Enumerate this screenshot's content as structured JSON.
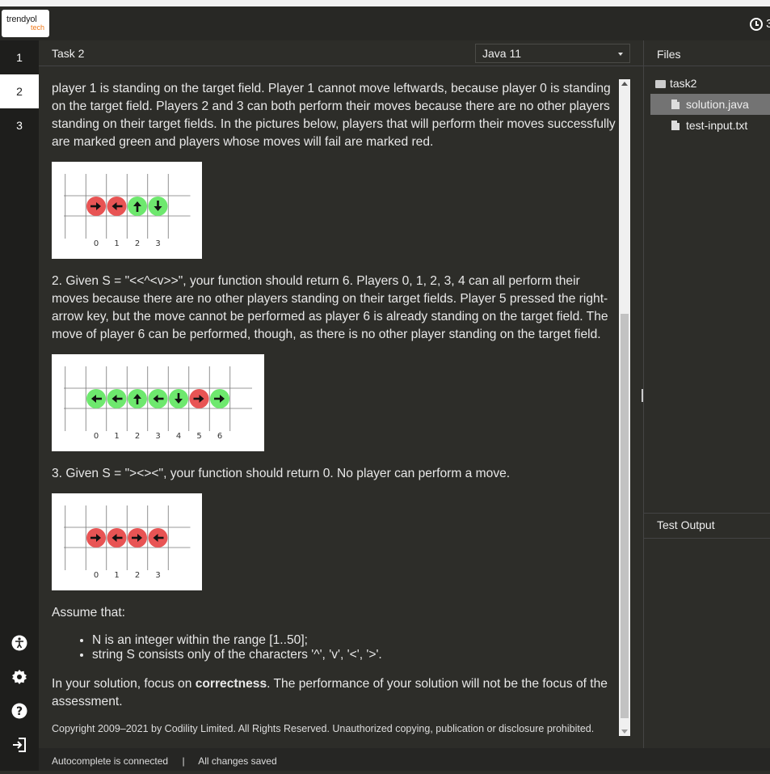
{
  "brand": {
    "line1": "trendyol",
    "line2": "tech"
  },
  "timer": {
    "text": "3"
  },
  "nav": {
    "tasks": [
      "1",
      "2",
      "3"
    ],
    "active": "2"
  },
  "nav_icons": [
    "accessibility-icon",
    "gear-icon",
    "help-icon",
    "logout-icon"
  ],
  "task": {
    "title": "Task 2",
    "language": "Java 11"
  },
  "content": {
    "para1": "player 1 is standing on the target field. Player 1 cannot move leftwards, because player 0 is standing on the target field. Players 2 and 3 can both perform their moves because there are no other players standing on their target fields. In the pictures below, players that will perform their moves successfully are marked green and players whose moves will fail are marked red.",
    "para2": "2. Given S = \"<<^<v>>\", your function should return 6. Players 0, 1, 2, 3, 4 can all perform their moves because there are no other players standing on their target fields. Player 5 pressed the right-arrow key, but the move cannot be performed as player 6 is already standing on the target field. The move of player 6 can be performed, though, as there is no other player standing on the target field.",
    "para3": "3. Given S = \"><><\", your function should return 0. No player can perform a move.",
    "assume": "Assume that:",
    "bullets": [
      "N is an integer within the range [1..50];",
      "string S consists only of the characters '^', 'v', '<', '>'."
    ],
    "focus_prefix": "In your solution, focus on ",
    "focus_bold": "correctness",
    "focus_suffix": ". The performance of your solution will not be the focus of the assessment.",
    "copyright": "Copyright 2009–2021 by Codility Limited. All Rights Reserved. Unauthorized copying, publication or disclosure prohibited."
  },
  "figures": [
    {
      "labels": [
        "0",
        "1",
        "2",
        "3"
      ],
      "colors": [
        "red",
        "red",
        "green",
        "green"
      ],
      "arrows": [
        "right",
        "left",
        "up",
        "down"
      ]
    },
    {
      "labels": [
        "0",
        "1",
        "2",
        "3",
        "4",
        "5",
        "6"
      ],
      "colors": [
        "green",
        "green",
        "green",
        "green",
        "green",
        "red",
        "green"
      ],
      "arrows": [
        "left",
        "left",
        "up",
        "left",
        "down",
        "right",
        "right"
      ]
    },
    {
      "labels": [
        "0",
        "1",
        "2",
        "3"
      ],
      "colors": [
        "red",
        "red",
        "red",
        "red"
      ],
      "arrows": [
        "right",
        "left",
        "right",
        "left"
      ]
    }
  ],
  "palette": {
    "red": "#e85454",
    "green": "#6ee86e"
  },
  "files": {
    "title": "Files",
    "folder": "task2",
    "items": [
      "solution.java",
      "test-input.txt"
    ],
    "active": "solution.java"
  },
  "output": {
    "title": "Test Output"
  },
  "status": {
    "autocomplete": "Autocomplete is connected",
    "separator": "|",
    "saved": "All changes saved"
  }
}
